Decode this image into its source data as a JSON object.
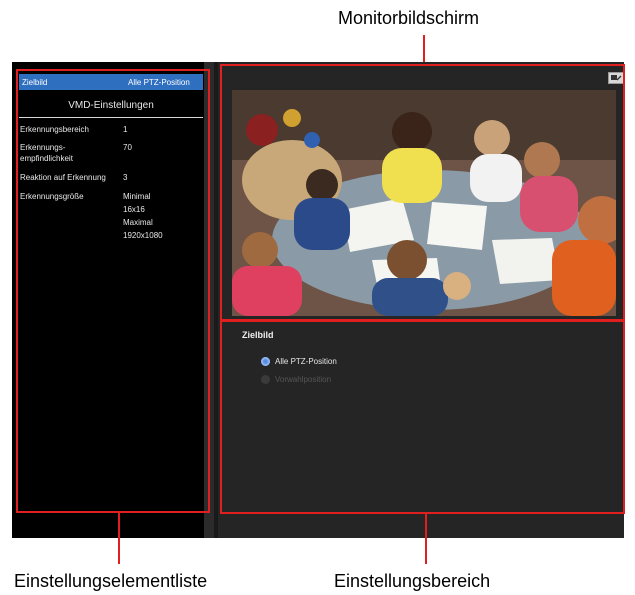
{
  "callouts": {
    "monitor": "Monitorbildschirm",
    "item_list": "Einstellungselementliste",
    "settings_area": "Einstellungsbereich"
  },
  "left_pane": {
    "selected_row": {
      "label": "Zielbild",
      "value": "Alle PTZ-Position"
    },
    "section_title": "VMD-Einstellungen",
    "properties": [
      {
        "label_lines": [
          "Erkennungsbereich"
        ],
        "value_lines": [
          "1"
        ]
      },
      {
        "label_lines": [
          "Erkennungs-",
          "empfindlichkeit"
        ],
        "value_lines": [
          "70"
        ]
      },
      {
        "label_lines": [
          "Reaktion auf Erkennung"
        ],
        "value_lines": [
          "3"
        ]
      },
      {
        "label_lines": [
          "Erkennungsgröße"
        ],
        "value_lines": [
          "Minimal",
          "16x16",
          "Maximal",
          "1920x1080"
        ]
      }
    ]
  },
  "right_pane": {
    "section_title": "Zielbild",
    "options": [
      {
        "label": "Alle PTZ-Position",
        "selected": true,
        "enabled": true
      },
      {
        "label": "Vorwahlposition",
        "selected": false,
        "enabled": false
      }
    ]
  },
  "colors": {
    "highlight": "#e02020",
    "selection": "#2f6fc0",
    "radio_selected": "#5b8fe0"
  }
}
